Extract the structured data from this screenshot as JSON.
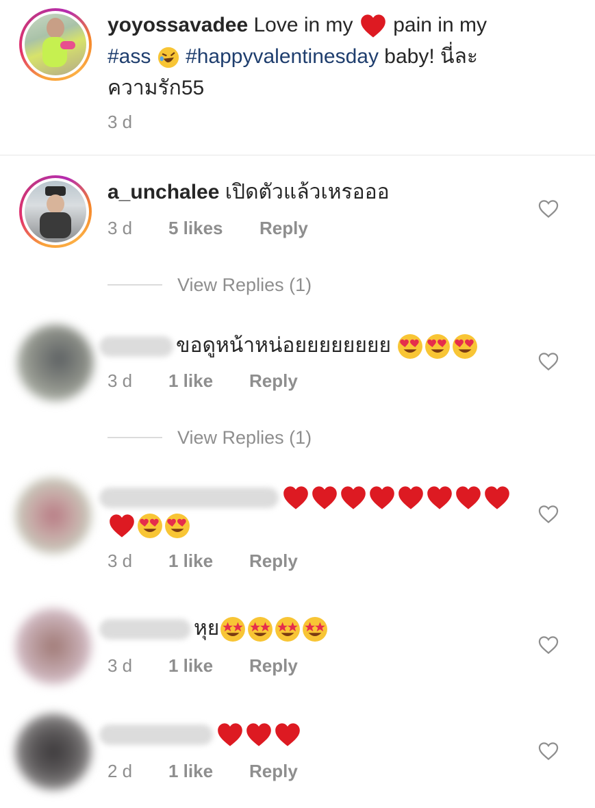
{
  "post": {
    "username": "yoyossavadee",
    "text1": "Love in my",
    "text2": "pain in my",
    "hashtag1": "#ass",
    "hashtag2": "#happyvalentinesday",
    "text3": "baby! นี่ละ",
    "text4": "ความรัก55",
    "time": "3 d"
  },
  "comments": [
    {
      "username": "a_unchalee",
      "text": "เปิดตัวแล้วเหรอออ",
      "time": "3 d",
      "likes": "5 likes",
      "reply": "Reply",
      "view_replies": "View Replies (1)"
    },
    {
      "text": "ขอดูหน้าหน่อยยยยยยยย",
      "time": "3 d",
      "likes": "1 like",
      "reply": "Reply",
      "view_replies": "View Replies (1)"
    },
    {
      "text": "",
      "time": "3 d",
      "likes": "1 like",
      "reply": "Reply"
    },
    {
      "text": "หุย",
      "time": "3 d",
      "likes": "1 like",
      "reply": "Reply"
    },
    {
      "text": "",
      "time": "2 d",
      "likes": "1 like",
      "reply": "Reply"
    }
  ],
  "icons": {
    "like": "heart-outline-icon",
    "emoji_heart": "red-heart-emoji",
    "emoji_love": "heart-eyes-emoji",
    "emoji_star": "star-struck-emoji",
    "emoji_laugh": "rolling-laughing-emoji"
  },
  "colors": {
    "hashtag": "#1f3e6e",
    "meta": "#8e8e8e",
    "heart": "#e0141f"
  }
}
